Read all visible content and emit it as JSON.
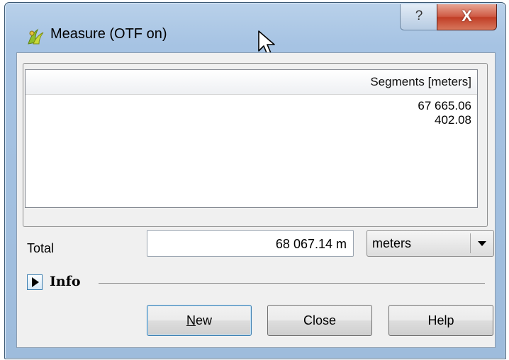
{
  "window": {
    "title": "Measure (OTF on)",
    "help_button_glyph": "?",
    "close_button_glyph": "X",
    "app_icon": "qgis-icon"
  },
  "table": {
    "column_header": "Segments [meters]",
    "rows": [
      "67 665.06",
      "402.08"
    ]
  },
  "total": {
    "label": "Total",
    "value": "68 067.14 m",
    "unit_selected": "meters"
  },
  "info": {
    "label": "Info",
    "expanded": false
  },
  "buttons": {
    "new_accel": "N",
    "new_rest": "ew",
    "close": "Close",
    "help": "Help"
  },
  "colors": {
    "titlebar": "#b9d1ea",
    "close_button": "#c13e26",
    "focus_border": "#3c7fb1"
  }
}
